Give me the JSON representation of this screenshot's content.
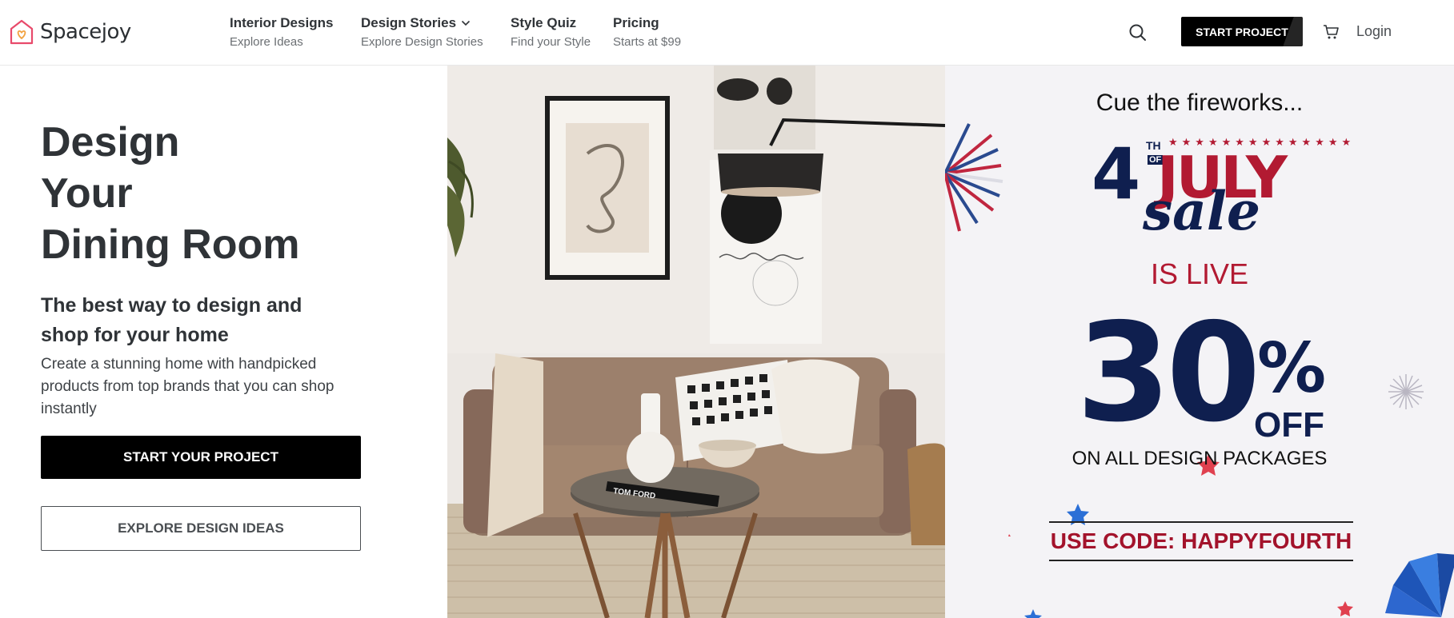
{
  "brand": {
    "name": "Spacejoy"
  },
  "nav": [
    {
      "title": "Interior Designs",
      "subtitle": "Explore Ideas",
      "has_dropdown": false
    },
    {
      "title": "Design Stories",
      "subtitle": "Explore Design Stories",
      "has_dropdown": true
    },
    {
      "title": "Style Quiz",
      "subtitle": "Find your Style",
      "has_dropdown": false
    },
    {
      "title": "Pricing",
      "subtitle": "Starts at $99",
      "has_dropdown": false
    }
  ],
  "header": {
    "cta_label": "START PROJECT",
    "login_label": "Login",
    "icons": {
      "search": "search-icon",
      "cart": "cart-icon",
      "dropdown": "chevron-down-icon"
    }
  },
  "hero": {
    "title_lines": [
      "Design",
      "Your",
      "Dining Room"
    ],
    "subtitle": "The best way to design and shop for your home",
    "description": "Create a stunning home with handpicked products from top brands that you can shop instantly",
    "primary_button": "START YOUR PROJECT",
    "secondary_button": "EXPLORE DESIGN IDEAS",
    "book_text": "TOM FORD"
  },
  "promo": {
    "cue": "Cue the fireworks...",
    "headline_number": "4",
    "headline_th": "TH",
    "headline_of": "OF",
    "headline_july": "JULY",
    "headline_sale": "sale",
    "is_live": "IS LIVE",
    "discount_number": "30",
    "discount_sign": "%",
    "discount_off": "OFF",
    "discount_scope": "ON ALL DESIGN PACKAGES",
    "promo_code": "USE CODE: HAPPYFOURTH",
    "colors": {
      "navy": "#0f1f4f",
      "red": "#b21a32",
      "background": "#f4f3f6"
    }
  }
}
